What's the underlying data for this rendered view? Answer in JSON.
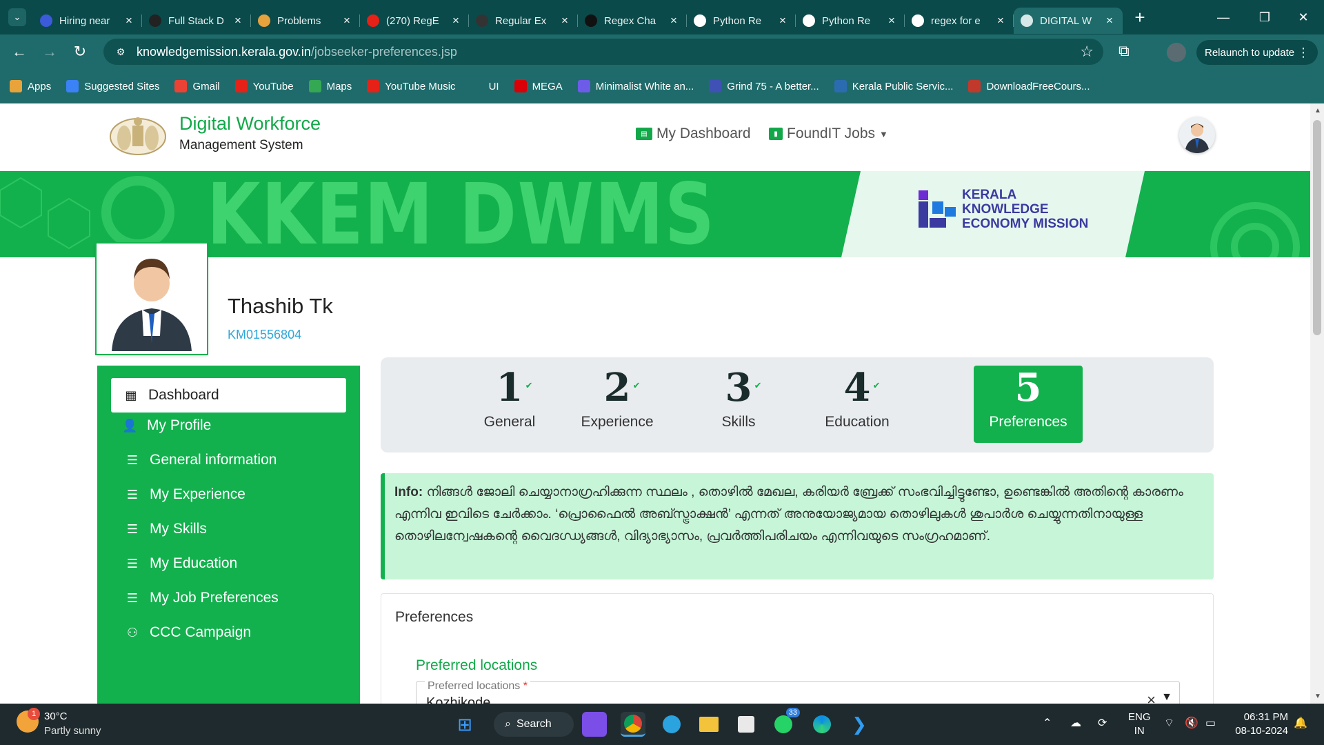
{
  "browser": {
    "tabs": [
      {
        "title": "Hiring near",
        "icon": "linkedin-icon",
        "color": "#3b5bdb"
      },
      {
        "title": "Full Stack D",
        "icon": "dev-icon",
        "color": "#222"
      },
      {
        "title": "Problems",
        "icon": "codeforces-icon",
        "color": "#e6a23c"
      },
      {
        "title": "(270) RegE",
        "icon": "youtube-icon",
        "color": "#e62117"
      },
      {
        "title": "Regular Ex",
        "icon": "regex-icon",
        "color": "#333"
      },
      {
        "title": "Regex Cha",
        "icon": "chatgpt-icon",
        "color": "#111"
      },
      {
        "title": "Python Re",
        "icon": "w3schools-icon",
        "color": "#fff"
      },
      {
        "title": "Python Re",
        "icon": "w3schools-icon",
        "color": "#fff"
      },
      {
        "title": "regex for e",
        "icon": "google-icon",
        "color": "#fff"
      },
      {
        "title": "DIGITAL W",
        "icon": "kerala-icon",
        "color": "#d6e8e8"
      }
    ],
    "url_host": "knowledgemission.kerala.gov.in",
    "url_path": "/jobseeker-preferences.jsp",
    "relaunch_label": "Relaunch to update",
    "bookmarks": [
      {
        "label": "Apps",
        "icon": "apps-grid-icon",
        "color": "#e8a33a"
      },
      {
        "label": "Suggested Sites",
        "icon": "search-icon",
        "color": "#3b82f6"
      },
      {
        "label": "Gmail",
        "icon": "gmail-icon",
        "color": "#ea4335"
      },
      {
        "label": "YouTube",
        "icon": "youtube-icon",
        "color": "#e62117"
      },
      {
        "label": "Maps",
        "icon": "maps-icon",
        "color": "#34a853"
      },
      {
        "label": "YouTube Music",
        "icon": "youtube-music-icon",
        "color": "#e62117"
      },
      {
        "label": "UI",
        "icon": "folder-icon",
        "color": "#1f6b6b"
      },
      {
        "label": "MEGA",
        "icon": "mega-icon",
        "color": "#d90007"
      },
      {
        "label": "Minimalist White an...",
        "icon": "bookmark-icon",
        "color": "#6c5ce7"
      },
      {
        "label": "Grind 75 - A better...",
        "icon": "grind75-icon",
        "color": "#3f51b5"
      },
      {
        "label": "Kerala Public Servic...",
        "icon": "kpsc-icon",
        "color": "#2b6cb0"
      },
      {
        "label": "DownloadFreeCours...",
        "icon": "download-icon",
        "color": "#c0392b"
      }
    ]
  },
  "site": {
    "brand_title": "Digital Workforce",
    "brand_subtitle": "Management System",
    "nav_dashboard": "My Dashboard",
    "nav_foundit": "FoundIT Jobs",
    "banner_text": "KKEM DWMS",
    "kkem_line1": "KERALA",
    "kkem_line2": "KNOWLEDGE",
    "kkem_line3": "ECONOMY MISSION",
    "profile_name": "Thashib Tk",
    "profile_id": "KM01556804",
    "sidebar": [
      {
        "label": "Dashboard",
        "icon": "dashboard-icon",
        "glyph": "▦"
      },
      {
        "label": "My Profile",
        "icon": "user-icon",
        "glyph": "👤"
      },
      {
        "label": "General information",
        "icon": "list-icon",
        "glyph": "☰"
      },
      {
        "label": "My Experience",
        "icon": "list-icon",
        "glyph": "☰"
      },
      {
        "label": "My Skills",
        "icon": "list-icon",
        "glyph": "☰"
      },
      {
        "label": "My Education",
        "icon": "list-icon",
        "glyph": "☰"
      },
      {
        "label": "My Job Preferences",
        "icon": "list-icon",
        "glyph": "☰"
      },
      {
        "label": "CCC Campaign",
        "icon": "users-icon",
        "glyph": "⚇"
      }
    ],
    "steps": [
      {
        "num": "1",
        "label": "General",
        "done": true
      },
      {
        "num": "2",
        "label": "Experience",
        "done": true
      },
      {
        "num": "3",
        "label": "Skills",
        "done": true
      },
      {
        "num": "4",
        "label": "Education",
        "done": true
      },
      {
        "num": "5",
        "label": "Preferences",
        "done": false
      }
    ],
    "info_label": "Info:",
    "info_text": "നിങ്ങൾ ജോലി ചെയ്യാനാഗ്രഹിക്കുന്ന സ്ഥലം , തൊഴിൽ മേഖല, കരിയർ ബ്രേക്ക് സംഭവിച്ചിട്ടുണ്ടോ, ഉണ്ടെങ്കിൽ അതിന്റെ കാരണം എന്നിവ ഇവിടെ ചേർക്കാം. ‘പ്രൊഫൈൽ അബ്സ്ട്രാക്ഷൻ’ എന്നത് അനുയോജ്യമായ തൊഴിലുകൾ ശുപാർശ ചെയ്യുന്നതിനായുള്ള തൊഴിലന്വേഷകന്റെ വൈദഗ്ധ്യങ്ങൾ, വിദ്യാഭ്യാസം, പ്രവർത്തിപരിചയം എന്നിവയുടെ സംഗ്രഹമാണ്.",
    "card_title": "Preferences",
    "pref_loc_heading": "Preferred locations",
    "pref_loc_label": "Preferred locations",
    "pref_loc_required": "*",
    "pref_loc_value": "Kozhikode",
    "accent": "#12b14d"
  },
  "taskbar": {
    "temp": "30°C",
    "weather": "Partly sunny",
    "weather_badge": "1",
    "search_label": "Search",
    "whatsapp_badge": "33",
    "lang1": "ENG",
    "lang2": "IN",
    "time": "06:31 PM",
    "date": "08-10-2024"
  }
}
